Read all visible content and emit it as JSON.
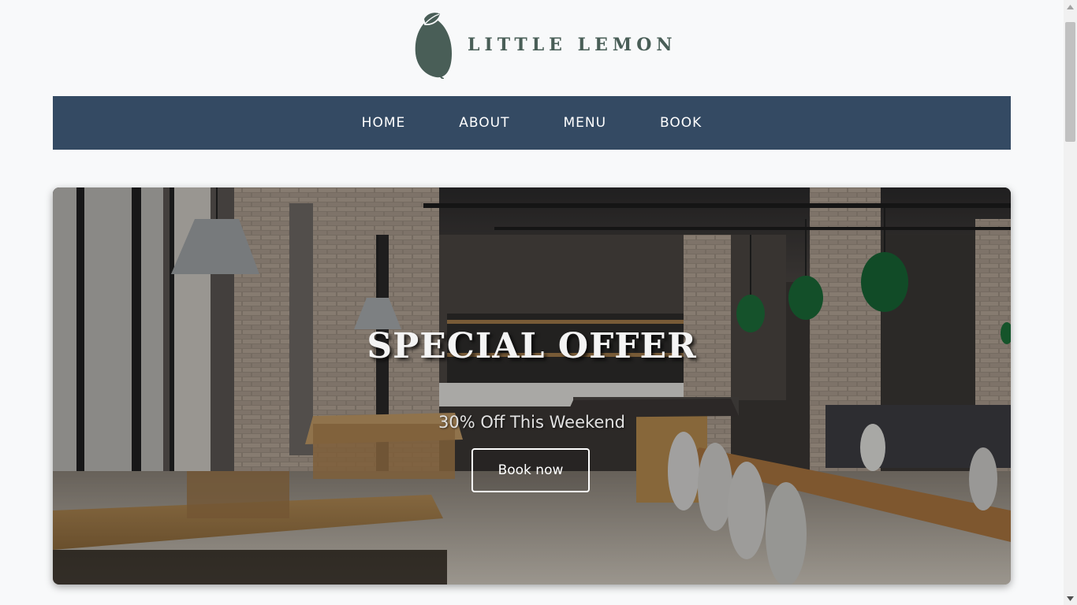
{
  "brand": {
    "name": "LITTLE LEMON",
    "logo_icon": "lemon-icon",
    "logo_color": "#495e57"
  },
  "nav": {
    "background": "#344a63",
    "items": [
      {
        "label": "HOME"
      },
      {
        "label": "ABOUT"
      },
      {
        "label": "MENU"
      },
      {
        "label": "BOOK"
      }
    ]
  },
  "hero": {
    "title": "SPECIAL OFFER",
    "subtitle": "30% Off This Weekend",
    "button_label": "Book now",
    "background_image": "restaurant-interior-photo"
  },
  "scrollbar": {
    "up_icon": "scroll-up-arrow-icon",
    "down_icon": "scroll-down-arrow-icon"
  }
}
